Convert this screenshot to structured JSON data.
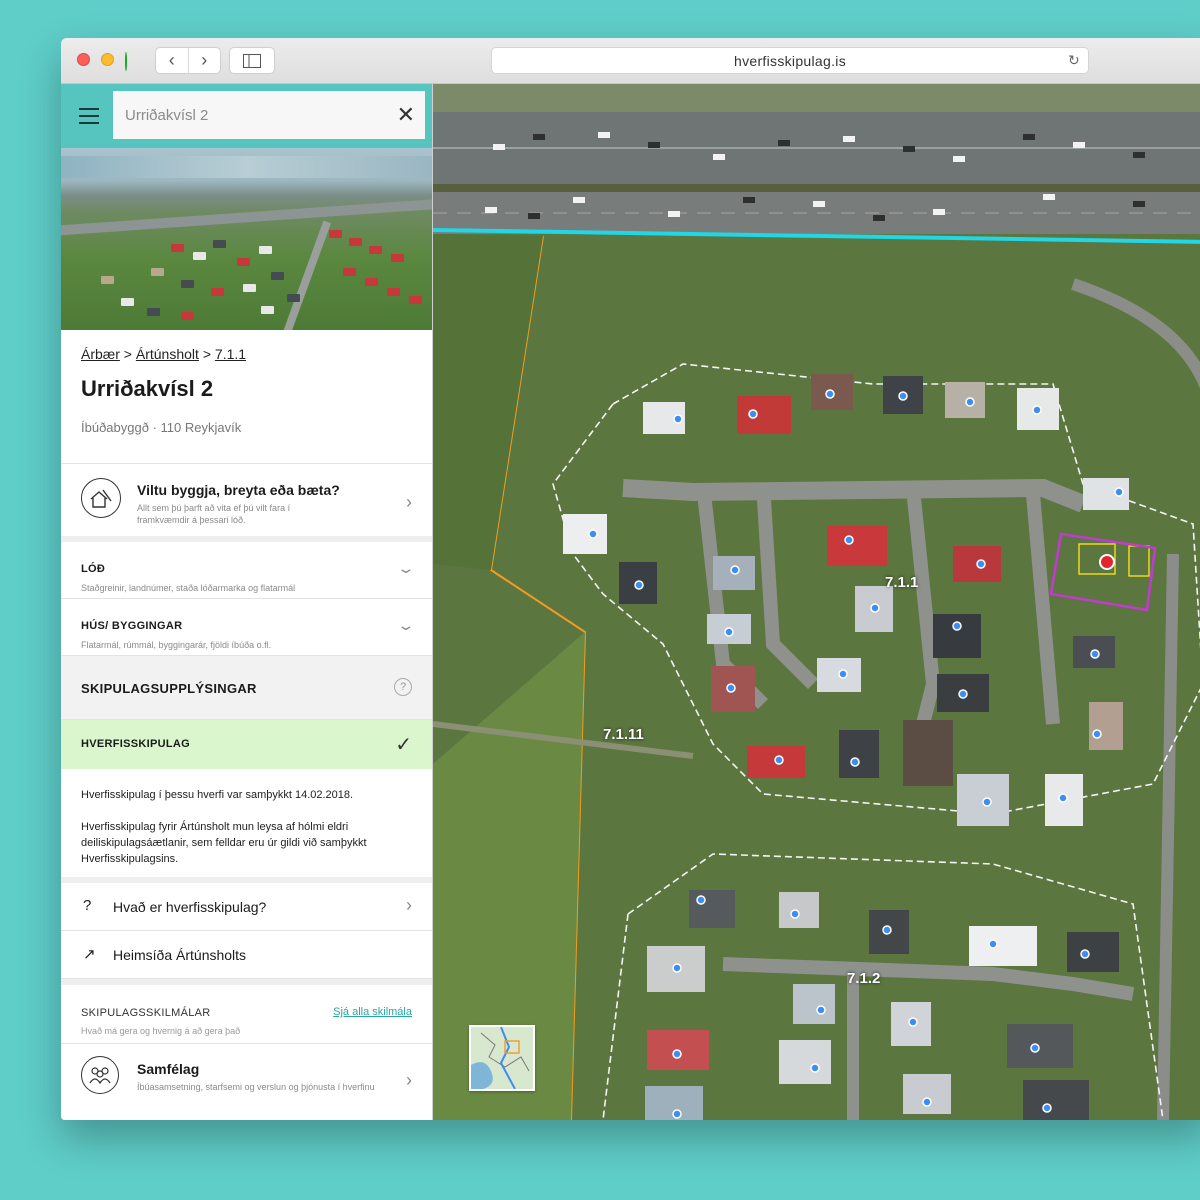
{
  "browser": {
    "url": "hverfisskipulag.is"
  },
  "search": {
    "value": "Urriðakvísl 2"
  },
  "breadcrumb": {
    "item1": "Árbær",
    "sep": ">",
    "item2": "Ártúnsholt",
    "item3": "7.1.1"
  },
  "property": {
    "title": "Urriðakvísl 2",
    "subtitle": "Íbúðabyggð · 110 Reykjavík"
  },
  "cta": {
    "heading": "Viltu byggja, breyta eða bæta?",
    "description": "Allt sem þú þarft að vita ef þú vilt fara í framkvæmdir á þessari lóð."
  },
  "accordions": [
    {
      "heading": "LÓÐ",
      "description": "Staðgreinir, landnúmer, staða lóðarmarka og flatarmál"
    },
    {
      "heading": "HÚS/ BYGGINGAR",
      "description": "Flatarmál, rúmmál, byggingarár, fjöldi íbúða o.fl."
    }
  ],
  "planning": {
    "heading": "SKIPULAGSUPPLÝSINGAR",
    "help": "?",
    "active_item": "HVERFISSKIPULAG",
    "paragraph1": "Hverfisskipulag í þessu hverfi var samþykkt 14.02.2018.",
    "paragraph2": "Hverfisskipulag fyrir Ártúnsholt mun leysa af hólmi eldri deiliskipulagsáætlanir, sem felldar eru úr gildi við samþykkt Hverfisskipulagsins."
  },
  "links": [
    {
      "icon": "?",
      "label": "Hvað er hverfisskipulag?"
    },
    {
      "icon": "↗",
      "label": "Heimsíða Ártúnsholts"
    }
  ],
  "terms": {
    "heading": "SKIPULAGSSKILMÁLAR",
    "description": "Hvað má gera og hvernig á að gera það",
    "link": "Sjá alla skilmála"
  },
  "community": {
    "heading": "Samfélag",
    "description": "Íbúasamsetning, starfsemi og verslun og þjónusta í hverfinu"
  },
  "map": {
    "zones": [
      "7.1.1",
      "7.1.11",
      "7.1.2"
    ],
    "colors": {
      "highway_boundary": "#21d6e6",
      "district_boundary": "#f39c1f",
      "selected_lot": "#c33ad0",
      "building_outline": "#f2e21a",
      "selected_marker": "#e0262c",
      "building_marker": "#3d8ef0"
    }
  }
}
